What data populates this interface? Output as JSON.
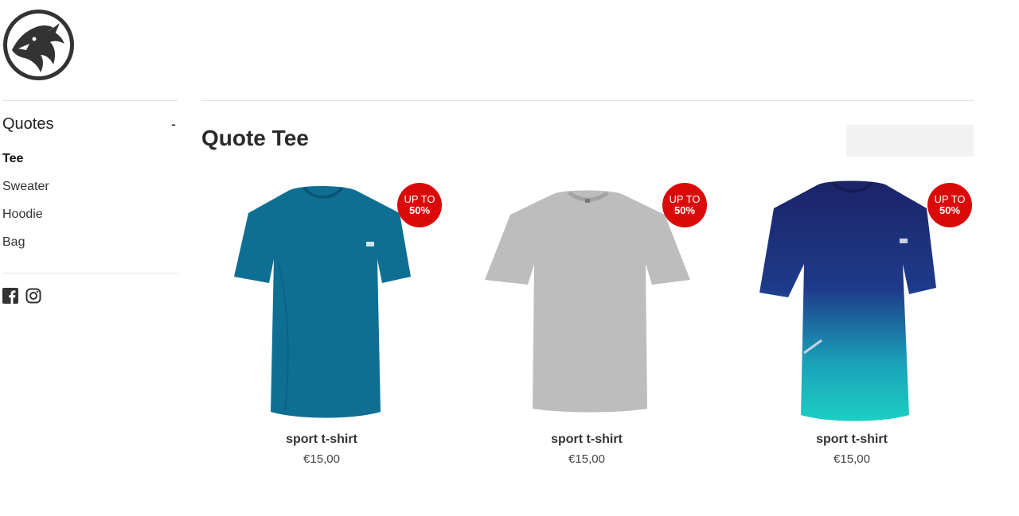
{
  "brand": {
    "logo_icon": "dragon-logo-icon"
  },
  "sidebar": {
    "category_title": "Quotes",
    "toggle": "-",
    "items": [
      {
        "label": "Tee",
        "active": true
      },
      {
        "label": "Sweater",
        "active": false
      },
      {
        "label": "Hoodie",
        "active": false
      },
      {
        "label": "Bag",
        "active": false
      }
    ],
    "social": [
      "facebook-icon",
      "instagram-icon"
    ]
  },
  "main": {
    "title": "Quote Tee",
    "products": [
      {
        "name": "sport t-shirt",
        "price": "€15,00",
        "badge_line1": "UP TO",
        "badge_line2": "50%",
        "color": "#0f6f93"
      },
      {
        "name": "sport t-shirt",
        "price": "€15,00",
        "badge_line1": "UP TO",
        "badge_line2": "50%",
        "color": "#bdbdbd"
      },
      {
        "name": "sport t-shirt",
        "price": "€15,00",
        "badge_line1": "UP TO",
        "badge_line2": "50%",
        "color": "#1c2a6b"
      }
    ]
  },
  "colors": {
    "badge": "#db0a0a",
    "text": "#222222",
    "divider": "#e3e3e3",
    "sort_box": "#f2f2f2"
  }
}
